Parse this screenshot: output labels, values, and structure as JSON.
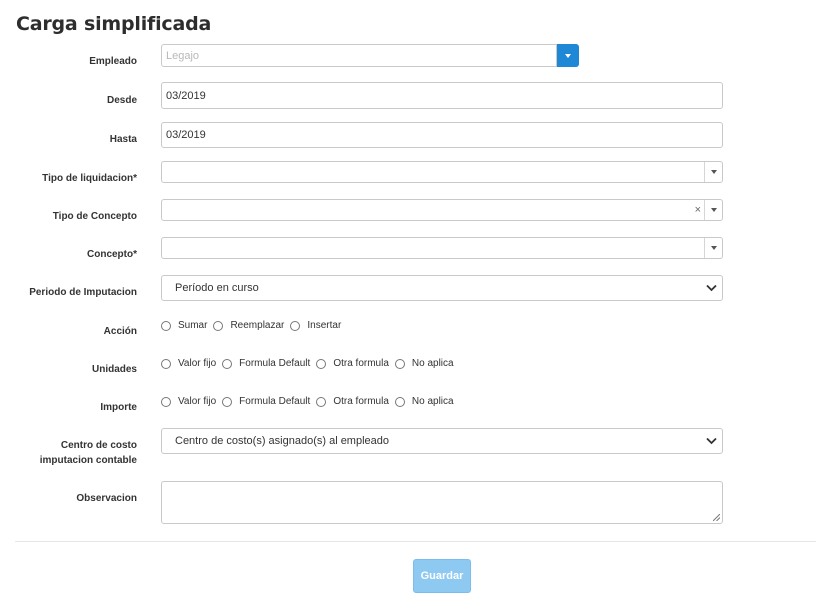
{
  "title": "Carga simplificada",
  "fields": {
    "empleado": {
      "label": "Empleado",
      "placeholder": "Legajo"
    },
    "desde": {
      "label": "Desde",
      "value": "03/2019"
    },
    "hasta": {
      "label": "Hasta",
      "value": "03/2019"
    },
    "tipo_liquidacion": {
      "label": "Tipo de liquidacion*",
      "value": ""
    },
    "tipo_concepto": {
      "label": "Tipo de Concepto",
      "value": "",
      "clear": "×"
    },
    "concepto": {
      "label": "Concepto*",
      "value": ""
    },
    "periodo": {
      "label": "Periodo de Imputacion",
      "value": "Período en curso"
    },
    "accion": {
      "label": "Acción",
      "options": [
        "Sumar",
        "Reemplazar",
        "Insertar"
      ]
    },
    "unidades": {
      "label": "Unidades",
      "options": [
        "Valor fijo",
        "Formula Default",
        "Otra formula",
        "No aplica"
      ]
    },
    "importe": {
      "label": "Importe",
      "options": [
        "Valor fijo",
        "Formula Default",
        "Otra formula",
        "No aplica"
      ]
    },
    "centro_costo": {
      "label_line1": "Centro de costo",
      "label_line2": "imputacion contable",
      "value": "Centro de costo(s) asignado(s) al empleado"
    },
    "observacion": {
      "label": "Observacion",
      "value": ""
    }
  },
  "save_button": "Guardar",
  "colors": {
    "accent": "#1e88d6",
    "button_disabled": "#8ec9f2"
  },
  "icons": [
    "chevron-down-icon",
    "caret-down-icon",
    "clear-icon",
    "resize-handle-icon"
  ]
}
